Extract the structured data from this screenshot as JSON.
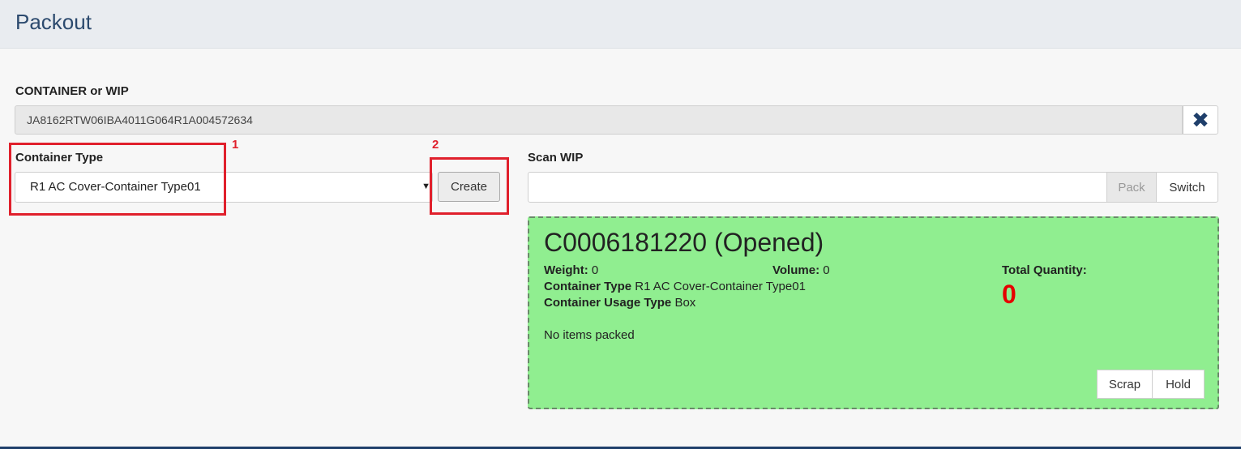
{
  "header": {
    "title": "Packout"
  },
  "container": {
    "label": "CONTAINER or WIP",
    "value": "JA8162RTW06IBA4011G064R1A004572634",
    "clear_icon": "close-icon"
  },
  "container_type": {
    "label": "Container Type",
    "selected": "R1 AC Cover-Container Type01",
    "create_label": "Create"
  },
  "annotations": {
    "one": "1",
    "two": "2",
    "color": "#e0202c"
  },
  "scan": {
    "label": "Scan WIP",
    "value": "",
    "pack_label": "Pack",
    "switch_label": "Switch"
  },
  "card": {
    "title": "C0006181220 (Opened)",
    "background": "#90ee90",
    "weight_label": "Weight:",
    "weight_value": "0",
    "volume_label": "Volume:",
    "volume_value": "0",
    "container_type_label": "Container Type",
    "container_type_value": "R1 AC Cover-Container Type01",
    "usage_type_label": "Container Usage Type",
    "usage_type_value": "Box",
    "total_quantity_label": "Total Quantity:",
    "total_quantity_value": "0",
    "no_items": "No items packed",
    "scrap_label": "Scrap",
    "hold_label": "Hold"
  }
}
